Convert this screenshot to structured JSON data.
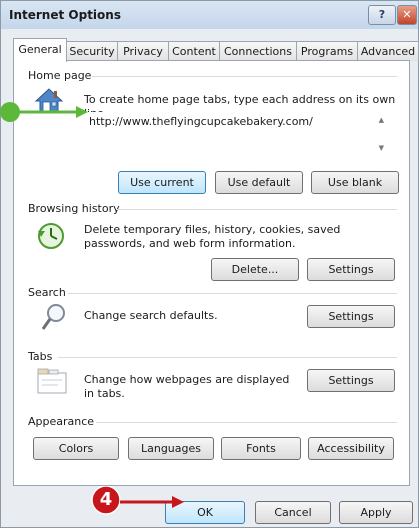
{
  "window": {
    "title": "Internet Options",
    "help_label": "?",
    "close_label": "✕"
  },
  "tabs": [
    {
      "label": "General"
    },
    {
      "label": "Security"
    },
    {
      "label": "Privacy"
    },
    {
      "label": "Content"
    },
    {
      "label": "Connections"
    },
    {
      "label": "Programs"
    },
    {
      "label": "Advanced"
    }
  ],
  "home_page": {
    "section_label": "Home page",
    "instructions": "To create home page tabs, type each address on its own line.",
    "url": "http://www.theflyingcupcakebakery.com/",
    "use_current": "Use current",
    "use_default": "Use default",
    "use_blank": "Use blank"
  },
  "browsing_history": {
    "section_label": "Browsing history",
    "description": "Delete temporary files, history, cookies, saved passwords, and web form information.",
    "delete_label": "Delete...",
    "settings_label": "Settings"
  },
  "search": {
    "section_label": "Search",
    "description": "Change search defaults.",
    "settings_label": "Settings"
  },
  "tabs_section": {
    "section_label": "Tabs",
    "description": "Change how webpages are displayed in tabs.",
    "settings_label": "Settings"
  },
  "appearance": {
    "section_label": "Appearance",
    "colors": "Colors",
    "languages": "Languages",
    "fonts": "Fonts",
    "accessibility": "Accessibility"
  },
  "footer": {
    "ok": "OK",
    "cancel": "Cancel",
    "apply": "Apply"
  },
  "annotations": {
    "step4": "4"
  },
  "colors": {
    "accent_green": "#5cb83a",
    "step_red": "#c8161d",
    "focus_blue": "#3c7fb1"
  }
}
